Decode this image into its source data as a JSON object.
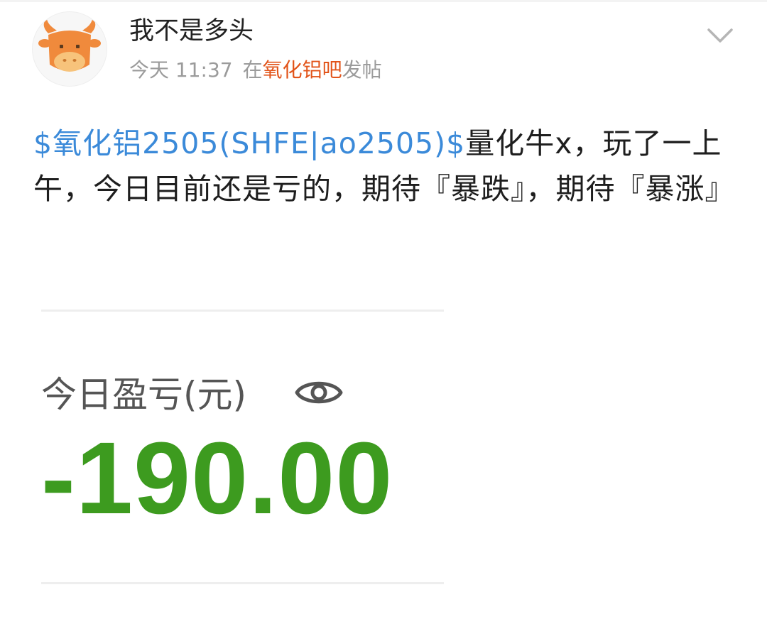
{
  "post": {
    "author": "我不是多头",
    "avatar_icon": "cow-avatar-icon",
    "time": "今天 11:37",
    "posted_in_prefix": "在",
    "forum_name": "氧化铝吧",
    "posted_in_suffix": "发帖",
    "more_icon": "chevron-down-icon",
    "body_tag": "$氧化铝2505(SHFE|ao2505)$",
    "body_text": "量化牛x，玩了一上午，今日目前还是亏的，期待『暴跌』，期待『暴涨』"
  },
  "screenshot": {
    "label": "今日盈亏(元)",
    "visibility_icon": "eye-icon",
    "value": "-190.00"
  },
  "colors": {
    "forum_link": "#e2541a",
    "stock_tag": "#3b8ad9",
    "loss_value": "#3d9b1f",
    "avatar_orange": "#f08a3c"
  }
}
